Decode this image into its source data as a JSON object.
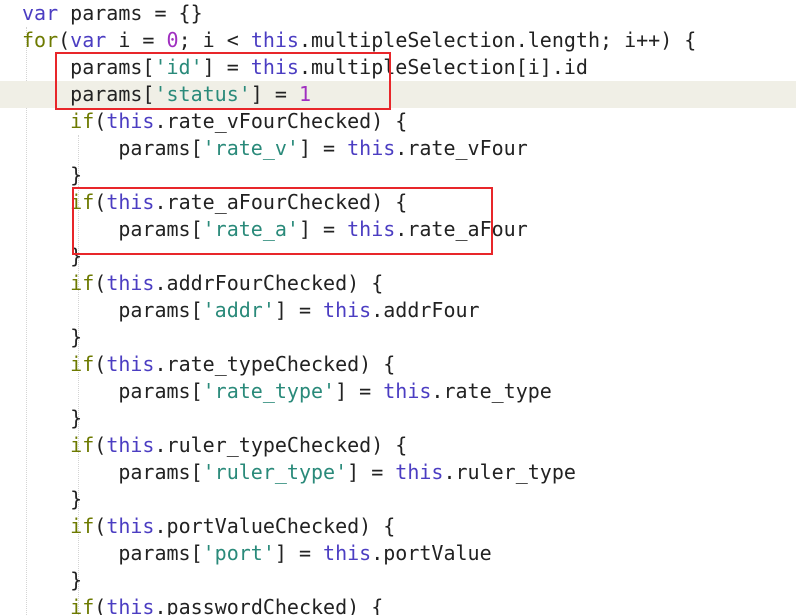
{
  "colors": {
    "keyword": "#4b3dc2",
    "control_keyword": "#6d7a00",
    "string": "#2a8a7a",
    "number": "#a02fc0",
    "plain": "#222222",
    "current_line_bg": "#f0efe6",
    "annotation_box": "#e8262a"
  },
  "code": {
    "lines": [
      [
        [
          "kw",
          "var"
        ],
        [
          "pl",
          " params = {}"
        ]
      ],
      [
        [
          "kw2",
          "for"
        ],
        [
          "pl",
          "("
        ],
        [
          "kw",
          "var"
        ],
        [
          "pl",
          " i = "
        ],
        [
          "num",
          "0"
        ],
        [
          "pl",
          "; i < "
        ],
        [
          "kw",
          "this"
        ],
        [
          "pl",
          ".multipleSelection.length; i++) {"
        ]
      ],
      [
        [
          "pl",
          "    params["
        ],
        [
          "str",
          "'id'"
        ],
        [
          "pl",
          "] = "
        ],
        [
          "kw",
          "this"
        ],
        [
          "pl",
          ".multipleSelection[i].id"
        ]
      ],
      [
        [
          "pl",
          "    params["
        ],
        [
          "str",
          "'status'"
        ],
        [
          "pl",
          "] = "
        ],
        [
          "num",
          "1"
        ]
      ],
      [
        [
          "pl",
          "    "
        ],
        [
          "kw2",
          "if"
        ],
        [
          "pl",
          "("
        ],
        [
          "kw",
          "this"
        ],
        [
          "pl",
          ".rate_vFourChecked) {"
        ]
      ],
      [
        [
          "pl",
          "        params["
        ],
        [
          "str",
          "'rate_v'"
        ],
        [
          "pl",
          "] = "
        ],
        [
          "kw",
          "this"
        ],
        [
          "pl",
          ".rate_vFour"
        ]
      ],
      [
        [
          "pl",
          "    }"
        ]
      ],
      [
        [
          "pl",
          "    "
        ],
        [
          "kw2",
          "if"
        ],
        [
          "pl",
          "("
        ],
        [
          "kw",
          "this"
        ],
        [
          "pl",
          ".rate_aFourChecked) {"
        ]
      ],
      [
        [
          "pl",
          "        params["
        ],
        [
          "str",
          "'rate_a'"
        ],
        [
          "pl",
          "] = "
        ],
        [
          "kw",
          "this"
        ],
        [
          "pl",
          ".rate_aFour"
        ]
      ],
      [
        [
          "pl",
          "    }"
        ]
      ],
      [
        [
          "pl",
          "    "
        ],
        [
          "kw2",
          "if"
        ],
        [
          "pl",
          "("
        ],
        [
          "kw",
          "this"
        ],
        [
          "pl",
          ".addrFourChecked) {"
        ]
      ],
      [
        [
          "pl",
          "        params["
        ],
        [
          "str",
          "'addr'"
        ],
        [
          "pl",
          "] = "
        ],
        [
          "kw",
          "this"
        ],
        [
          "pl",
          ".addrFour"
        ]
      ],
      [
        [
          "pl",
          "    }"
        ]
      ],
      [
        [
          "pl",
          "    "
        ],
        [
          "kw2",
          "if"
        ],
        [
          "pl",
          "("
        ],
        [
          "kw",
          "this"
        ],
        [
          "pl",
          ".rate_typeChecked) {"
        ]
      ],
      [
        [
          "pl",
          "        params["
        ],
        [
          "str",
          "'rate_type'"
        ],
        [
          "pl",
          "] = "
        ],
        [
          "kw",
          "this"
        ],
        [
          "pl",
          ".rate_type"
        ]
      ],
      [
        [
          "pl",
          "    }"
        ]
      ],
      [
        [
          "pl",
          "    "
        ],
        [
          "kw2",
          "if"
        ],
        [
          "pl",
          "("
        ],
        [
          "kw",
          "this"
        ],
        [
          "pl",
          ".ruler_typeChecked) {"
        ]
      ],
      [
        [
          "pl",
          "        params["
        ],
        [
          "str",
          "'ruler_type'"
        ],
        [
          "pl",
          "] = "
        ],
        [
          "kw",
          "this"
        ],
        [
          "pl",
          ".ruler_type"
        ]
      ],
      [
        [
          "pl",
          "    }"
        ]
      ],
      [
        [
          "pl",
          "    "
        ],
        [
          "kw2",
          "if"
        ],
        [
          "pl",
          "("
        ],
        [
          "kw",
          "this"
        ],
        [
          "pl",
          ".portValueChecked) {"
        ]
      ],
      [
        [
          "pl",
          "        params["
        ],
        [
          "str",
          "'port'"
        ],
        [
          "pl",
          "] = "
        ],
        [
          "kw",
          "this"
        ],
        [
          "pl",
          ".portValue"
        ]
      ],
      [
        [
          "pl",
          "    }"
        ]
      ],
      [
        [
          "pl",
          "    "
        ],
        [
          "kw2",
          "if"
        ],
        [
          "pl",
          "("
        ],
        [
          "kw",
          "this"
        ],
        [
          "pl",
          ".passwordChecked) {"
        ]
      ]
    ],
    "current_line": 3
  },
  "annotations": [
    {
      "label": "red-box-status-lines"
    },
    {
      "label": "red-box-rate-a-lines"
    }
  ]
}
